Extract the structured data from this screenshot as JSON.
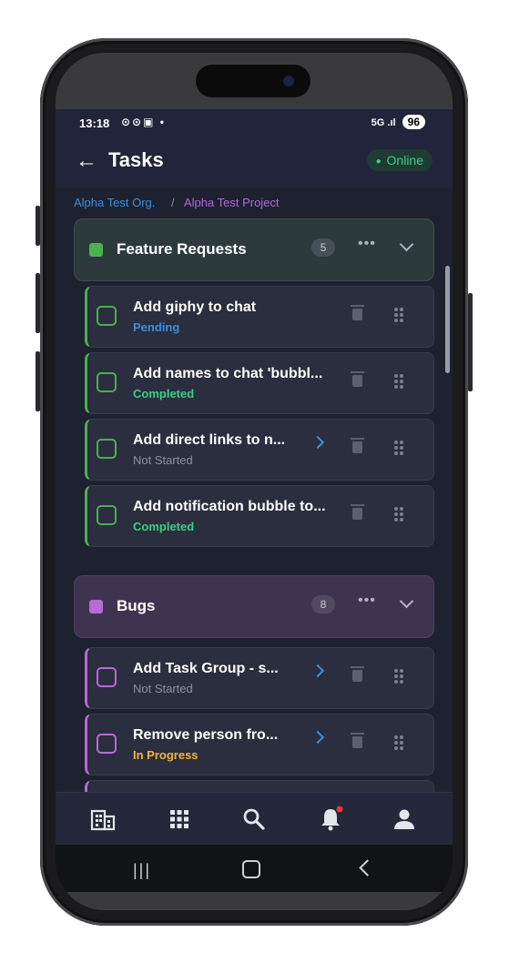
{
  "status_bar": {
    "time": "13:18",
    "notification_icons": "⊙⊙▣ •",
    "signal": "5G .ıl",
    "battery": "96"
  },
  "header": {
    "back_icon": "arrow-left-icon",
    "title": "Tasks",
    "status_label": "Online"
  },
  "breadcrumb": {
    "org": "Alpha Test Org.",
    "separator": "/",
    "project": "Alpha Test Project"
  },
  "groups": [
    {
      "name": "Feature Requests",
      "count": "5",
      "color": "#4caf50",
      "tasks": [
        {
          "title": "Add giphy to chat",
          "status": "Pending"
        },
        {
          "title": "Add names to chat 'bubbl...",
          "status": "Completed"
        },
        {
          "title": "Add direct links to n...",
          "status": "Not Started"
        },
        {
          "title": "Add notification bubble to...",
          "status": "Completed"
        }
      ]
    },
    {
      "name": "Bugs",
      "count": "8",
      "color": "#b86ad6",
      "tasks": [
        {
          "title": "Add Task Group - s...",
          "status": "Not Started"
        },
        {
          "title": "Remove person fro...",
          "status": "In Progress"
        }
      ]
    }
  ],
  "more_label": "•••",
  "bottom_nav": [
    "building-icon",
    "grid-icon",
    "search-icon",
    "bell-icon",
    "person-icon"
  ],
  "system_nav": {
    "recents": "|||"
  },
  "colors": {
    "accent_blue": "#3b8fe0",
    "online_green": "#3ccf86",
    "progress_orange": "#f2b33d",
    "purple": "#b06ad8"
  }
}
